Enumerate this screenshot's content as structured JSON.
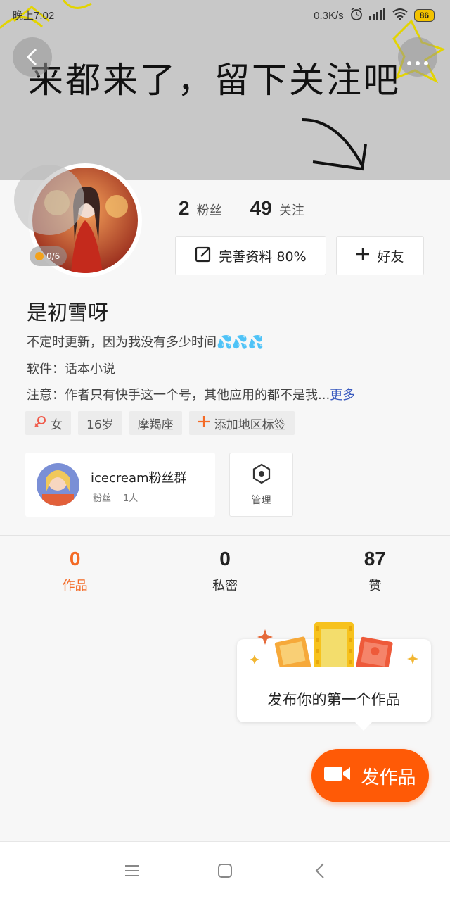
{
  "status_bar": {
    "time": "晚上7:02",
    "net_speed": "0.3K/s",
    "battery": "86",
    "icons": [
      "alarm-icon",
      "signal-icon",
      "wifi-icon",
      "battery-icon"
    ]
  },
  "cover": {
    "text": "来都来了，留下关注吧"
  },
  "top_bar": {
    "back_icon": "chevron-left-icon",
    "more_icon": "more-dots-icon"
  },
  "avatar_badge": "0/6",
  "stats": {
    "fans_count": "2",
    "fans_label": "粉丝",
    "follow_count": "49",
    "follow_label": "关注"
  },
  "buttons": {
    "complete_profile": "完善资料 80%",
    "add_friend": "好友"
  },
  "profile": {
    "name": "是初雪呀",
    "bio_line1": "不定时更新，因为我没有多少时间💦💦💦",
    "bio_line2": "软件：话本小说",
    "bio_line3": "注意：作者只有快手这一个号，其他应用的都不是我...",
    "more_link": "更多"
  },
  "tags": {
    "gender": "女",
    "age": "16岁",
    "zodiac": "摩羯座",
    "add_location": "添加地区标签"
  },
  "fan_group": {
    "name": "icecream粉丝群",
    "meta_label": "粉丝",
    "meta_count": "1人",
    "manage_label": "管理"
  },
  "tabs": [
    {
      "count": "0",
      "label": "作品",
      "active": true
    },
    {
      "count": "0",
      "label": "私密",
      "active": false
    },
    {
      "count": "87",
      "label": "赞",
      "active": false
    }
  ],
  "tip": {
    "text": "发布你的第一个作品"
  },
  "publish": {
    "label": "发作品"
  },
  "colors": {
    "accent": "#ff5a06",
    "tab_active": "#f46a25",
    "cover_bg": "#c8c8c8",
    "link": "#3a5bbf"
  }
}
